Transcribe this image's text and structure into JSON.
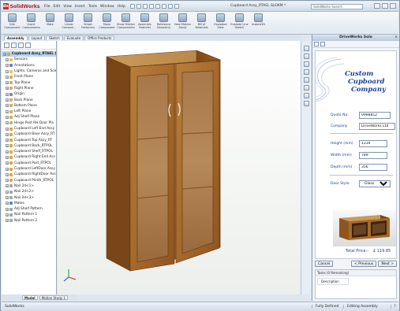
{
  "app": {
    "logo_text": "SolidWorks",
    "search_placeholder": "SolidWorks Search",
    "document_title": "Cupboard Assy_RTAEL SLOKM *"
  },
  "menu": [
    "File",
    "Edit",
    "View",
    "Insert",
    "Tools",
    "Window",
    "Help"
  ],
  "ribbon": [
    {
      "label": "Edit Component",
      "icon": "edit-component-icon"
    },
    {
      "label": "Insert Components",
      "icon": "insert-components-icon"
    },
    {
      "label": "Mate",
      "icon": "mate-icon"
    },
    {
      "label": "Linear Compon...",
      "icon": "linear-pattern-icon"
    },
    {
      "label": "Smart Fasteners",
      "icon": "smart-fasteners-icon"
    },
    {
      "label": "Move Component",
      "icon": "move-component-icon"
    },
    {
      "label": "Show Hidden Components",
      "icon": "show-hidden-icon"
    },
    {
      "label": "Assembly Features",
      "icon": "assembly-features-icon"
    },
    {
      "label": "Reference Geometry",
      "icon": "reference-geometry-icon"
    },
    {
      "label": "New Motion Study",
      "icon": "motion-study-icon"
    },
    {
      "label": "Bill of Materials",
      "icon": "bom-icon"
    },
    {
      "label": "Exploded View",
      "icon": "exploded-view-icon"
    },
    {
      "label": "Explode Line Sketch",
      "icon": "explode-line-icon"
    },
    {
      "label": "Instant3D",
      "icon": "instant3d-icon"
    }
  ],
  "tabs": [
    "Assembly",
    "Layout",
    "Sketch",
    "Evaluate",
    "Office Products"
  ],
  "tree": [
    {
      "label": "Cupboard Assy_RTAEL (De",
      "color": "#e3a53a",
      "root": true
    },
    {
      "label": "Sensors",
      "color": "#f0c05a"
    },
    {
      "label": "Annotations",
      "color": "#5a86c4"
    },
    {
      "label": "Lights, Cameras and Sce",
      "color": "#f0c05a"
    },
    {
      "label": "Front Plane",
      "color": "#c9b06a"
    },
    {
      "label": "Top Plane",
      "color": "#c9b06a"
    },
    {
      "label": "Right Plane",
      "color": "#c9b06a"
    },
    {
      "label": "Origin",
      "color": "#7a8da8"
    },
    {
      "label": "Back Plane",
      "color": "#c9b06a"
    },
    {
      "label": "Bottom Plane",
      "color": "#c9b06a"
    },
    {
      "label": "Left Plane",
      "color": "#c9b06a"
    },
    {
      "label": "Adj Shelf Plane",
      "color": "#c9b06a"
    },
    {
      "label": "Hinge Post RH Door Pla",
      "color": "#c9b06a"
    },
    {
      "label": "Cupboard Left End Assy",
      "color": "#e3a53a"
    },
    {
      "label": "Cupboard Base Assy_RT",
      "color": "#e3a53a"
    },
    {
      "label": "Cupboard Top Assy_RT",
      "color": "#e3a53a"
    },
    {
      "label": "Cupboard Back_RTPOL",
      "color": "#e3a53a"
    },
    {
      "label": "Cupboard Shelf_RTPOL",
      "color": "#e3a53a"
    },
    {
      "label": "Cupboard Right End Ass",
      "color": "#e3a53a"
    },
    {
      "label": "Cupboard Post_RTPOL",
      "color": "#e3a53a"
    },
    {
      "label": "Cupboard LeftDoor Assy",
      "color": "#e3a53a"
    },
    {
      "label": "Cupboard RightDoor Ass",
      "color": "#e3a53a"
    },
    {
      "label": "Cupboard Plinth_RTPOL",
      "color": "#e3a53a"
    },
    {
      "label": "Nail 2d<1>",
      "color": "#9aa6b4"
    },
    {
      "label": "Nail 2d<2>",
      "color": "#9aa6b4"
    },
    {
      "label": "Nail 2d<3>",
      "color": "#9aa6b4"
    },
    {
      "label": "Mates",
      "color": "#5a86c4"
    },
    {
      "label": "Adj Shelf Pattern",
      "color": "#9aa6b4"
    },
    {
      "label": "Nail Pattern 1",
      "color": "#9aa6b4"
    },
    {
      "label": "Nail Pattern 2",
      "color": "#9aa6b4"
    }
  ],
  "bottom_tabs": [
    "Model",
    "Motion Study 1"
  ],
  "panel": {
    "title": "DriveWorks Solo",
    "brand": [
      "Custom",
      "Cupboard",
      "Company"
    ],
    "quote_label": "Quote No:",
    "quote_value": "0998812",
    "company_label": "Company",
    "company_value": "DriveWorks Ltd",
    "height_label": "Height (mm)",
    "height_value": "1234",
    "width_label": "Width (mm)",
    "width_value": "789",
    "depth_label": "Depth (mm)",
    "depth_value": "356",
    "door_label": "Door Style",
    "door_value": "Glass",
    "total_label": "Total Price:-",
    "total_value": "£ 119.85",
    "cancel": "Cancel",
    "previous": "< Previous",
    "next": "Next >",
    "tasks_title": "Tasks (0 Remaining)",
    "tasks_column": "Description"
  },
  "status": {
    "app": "SolidWorks",
    "state": "Fully Defined",
    "mode": "Editing Assembly"
  }
}
